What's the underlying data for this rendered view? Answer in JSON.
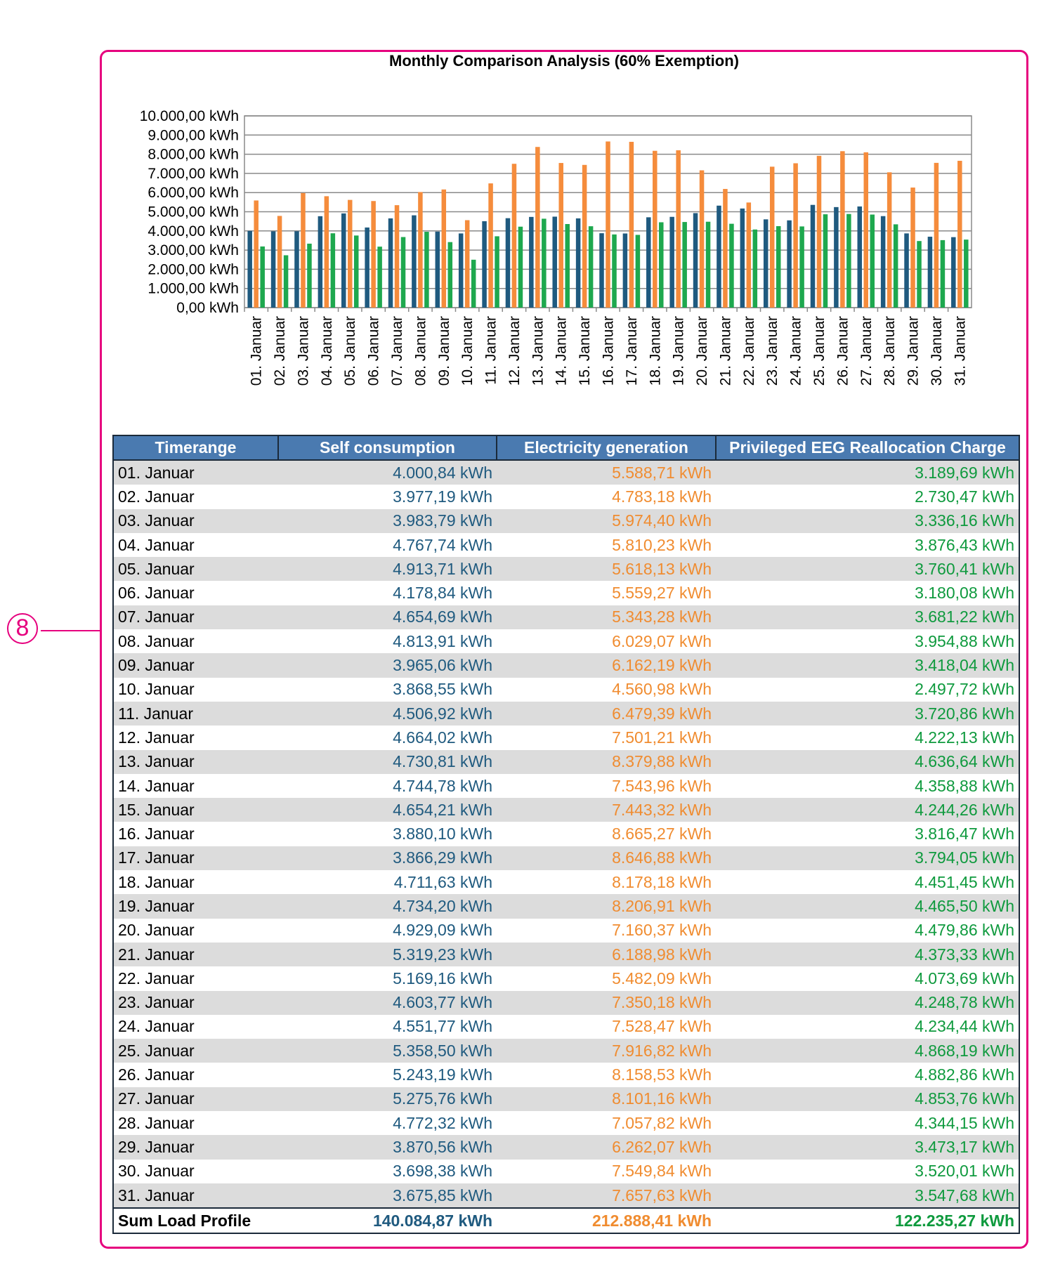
{
  "chart_data": {
    "type": "bar",
    "title": "Monthly Comparison Analysis (60% Exemption)",
    "ylim": [
      0,
      10000
    ],
    "y_tick_labels": [
      "0,00 kWh",
      "1.000,00 kWh",
      "2.000,00 kWh",
      "3.000,00 kWh",
      "4.000,00 kWh",
      "5.000,00 kWh",
      "6.000,00 kWh",
      "7.000,00 kWh",
      "8.000,00 kWh",
      "9.000,00 kWh",
      "10.000,00 kWh"
    ],
    "grid": true,
    "legend": "none",
    "categories": [
      "01. Januar",
      "02. Januar",
      "03. Januar",
      "04. Januar",
      "05. Januar",
      "06. Januar",
      "07. Januar",
      "08. Januar",
      "09. Januar",
      "10. Januar",
      "11. Januar",
      "12. Januar",
      "13. Januar",
      "14. Januar",
      "15. Januar",
      "16. Januar",
      "17. Januar",
      "18. Januar",
      "19. Januar",
      "20. Januar",
      "21. Januar",
      "22. Januar",
      "23. Januar",
      "24. Januar",
      "25. Januar",
      "26. Januar",
      "27. Januar",
      "28. Januar",
      "29. Januar",
      "30. Januar",
      "31. Januar"
    ],
    "series": [
      {
        "name": "Self consumption",
        "color": "#1f5a7f",
        "values": [
          4000.84,
          3977.19,
          3983.79,
          4767.74,
          4913.71,
          4178.84,
          4654.69,
          4813.91,
          3965.06,
          3868.55,
          4506.92,
          4664.02,
          4730.81,
          4744.78,
          4654.21,
          3880.1,
          3866.29,
          4711.63,
          4734.2,
          4929.09,
          5319.23,
          5169.16,
          4603.77,
          4551.77,
          5358.5,
          5243.19,
          5275.76,
          4772.32,
          3870.56,
          3698.38,
          3675.85
        ]
      },
      {
        "name": "Electricity generation",
        "color": "#f58c3c",
        "values": [
          5588.71,
          4783.18,
          5974.4,
          5810.23,
          5618.13,
          5559.27,
          5343.28,
          6029.07,
          6162.19,
          4560.98,
          6479.39,
          7501.21,
          8379.88,
          7543.96,
          7443.32,
          8665.27,
          8646.88,
          8178.18,
          8206.91,
          7160.37,
          6188.98,
          5482.09,
          7350.18,
          7528.47,
          7916.82,
          8158.53,
          8101.16,
          7057.82,
          6262.07,
          7549.84,
          7657.63
        ]
      },
      {
        "name": "Privileged EEG Reallocation Charge",
        "color": "#1ea84e",
        "values": [
          3189.69,
          2730.47,
          3336.16,
          3876.43,
          3760.41,
          3180.08,
          3681.22,
          3954.88,
          3418.04,
          2497.72,
          3720.86,
          4222.13,
          4636.64,
          4358.88,
          4244.26,
          3816.47,
          3794.05,
          4451.45,
          4465.5,
          4479.86,
          4373.33,
          4073.69,
          4248.78,
          4234.44,
          4868.19,
          4882.86,
          4853.76,
          4344.15,
          3473.17,
          3520.01,
          3547.68
        ]
      }
    ]
  },
  "callout": {
    "label": "8"
  },
  "table": {
    "headers": [
      "Timerange",
      "Self consumption",
      "Electricity generation",
      "Privileged EEG Reallocation Charge"
    ],
    "rows": [
      [
        "01. Januar",
        "4.000,84 kWh",
        "5.588,71 kWh",
        "3.189,69 kWh"
      ],
      [
        "02. Januar",
        "3.977,19 kWh",
        "4.783,18 kWh",
        "2.730,47 kWh"
      ],
      [
        "03. Januar",
        "3.983,79 kWh",
        "5.974,40 kWh",
        "3.336,16 kWh"
      ],
      [
        "04. Januar",
        "4.767,74 kWh",
        "5.810,23 kWh",
        "3.876,43 kWh"
      ],
      [
        "05. Januar",
        "4.913,71 kWh",
        "5.618,13 kWh",
        "3.760,41 kWh"
      ],
      [
        "06. Januar",
        "4.178,84 kWh",
        "5.559,27 kWh",
        "3.180,08 kWh"
      ],
      [
        "07. Januar",
        "4.654,69 kWh",
        "5.343,28 kWh",
        "3.681,22 kWh"
      ],
      [
        "08. Januar",
        "4.813,91 kWh",
        "6.029,07 kWh",
        "3.954,88 kWh"
      ],
      [
        "09. Januar",
        "3.965,06 kWh",
        "6.162,19 kWh",
        "3.418,04 kWh"
      ],
      [
        "10. Januar",
        "3.868,55 kWh",
        "4.560,98 kWh",
        "2.497,72 kWh"
      ],
      [
        "11. Januar",
        "4.506,92 kWh",
        "6.479,39 kWh",
        "3.720,86 kWh"
      ],
      [
        "12. Januar",
        "4.664,02 kWh",
        "7.501,21 kWh",
        "4.222,13 kWh"
      ],
      [
        "13. Januar",
        "4.730,81 kWh",
        "8.379,88 kWh",
        "4.636,64 kWh"
      ],
      [
        "14. Januar",
        "4.744,78 kWh",
        "7.543,96 kWh",
        "4.358,88 kWh"
      ],
      [
        "15. Januar",
        "4.654,21 kWh",
        "7.443,32 kWh",
        "4.244,26 kWh"
      ],
      [
        "16. Januar",
        "3.880,10 kWh",
        "8.665,27 kWh",
        "3.816,47 kWh"
      ],
      [
        "17. Januar",
        "3.866,29 kWh",
        "8.646,88 kWh",
        "3.794,05 kWh"
      ],
      [
        "18. Januar",
        "4.711,63 kWh",
        "8.178,18 kWh",
        "4.451,45 kWh"
      ],
      [
        "19. Januar",
        "4.734,20 kWh",
        "8.206,91 kWh",
        "4.465,50 kWh"
      ],
      [
        "20. Januar",
        "4.929,09 kWh",
        "7.160,37 kWh",
        "4.479,86 kWh"
      ],
      [
        "21. Januar",
        "5.319,23 kWh",
        "6.188,98 kWh",
        "4.373,33 kWh"
      ],
      [
        "22. Januar",
        "5.169,16 kWh",
        "5.482,09 kWh",
        "4.073,69 kWh"
      ],
      [
        "23. Januar",
        "4.603,77 kWh",
        "7.350,18 kWh",
        "4.248,78 kWh"
      ],
      [
        "24. Januar",
        "4.551,77 kWh",
        "7.528,47 kWh",
        "4.234,44 kWh"
      ],
      [
        "25. Januar",
        "5.358,50 kWh",
        "7.916,82 kWh",
        "4.868,19 kWh"
      ],
      [
        "26. Januar",
        "5.243,19 kWh",
        "8.158,53 kWh",
        "4.882,86 kWh"
      ],
      [
        "27. Januar",
        "5.275,76 kWh",
        "8.101,16 kWh",
        "4.853,76 kWh"
      ],
      [
        "28. Januar",
        "4.772,32 kWh",
        "7.057,82 kWh",
        "4.344,15 kWh"
      ],
      [
        "29. Januar",
        "3.870,56 kWh",
        "6.262,07 kWh",
        "3.473,17 kWh"
      ],
      [
        "30. Januar",
        "3.698,38 kWh",
        "7.549,84 kWh",
        "3.520,01 kWh"
      ],
      [
        "31. Januar",
        "3.675,85 kWh",
        "7.657,63 kWh",
        "3.547,68 kWh"
      ]
    ],
    "sum": [
      "Sum Load Profile",
      "140.084,87 kWh",
      "212.888,41 kWh",
      "122.235,27 kWh"
    ]
  },
  "colors": {
    "frame": "#e6007e",
    "header_bg": "#4a7ab0",
    "self": "#1f5a7f",
    "generation": "#f58c3c",
    "eeg": "#1ea84e"
  }
}
